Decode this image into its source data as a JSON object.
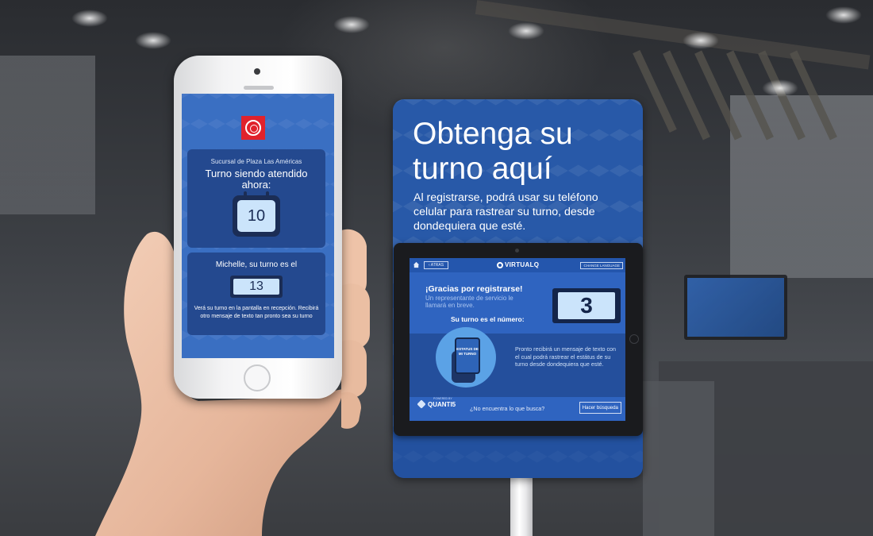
{
  "phone": {
    "branch": "Sucursal de Plaza Las Américas",
    "now_serving": "Turno siendo atendido ahora:",
    "serving_number": "10",
    "user_line": "Michelle, su turno es el",
    "user_number": "13",
    "message": "Verá su turno en la pantalla en recepción. Recibirá otro mensaje de texto tan pronto sea su turno"
  },
  "kiosk": {
    "title": "Obtenga su turno aquí",
    "subtitle": "Al registrarse, podrá usar su teléfono celular para rastrear su turno, desde dondequiera que esté."
  },
  "tablet": {
    "back_label": "‹ ATRAS",
    "brand": "VIRTUALQ",
    "language_label": "CHANGE LANGUAGE",
    "thanks": "¡Gracias por registrarse!",
    "representative": "Un representante de servicio le llamará en breve.",
    "your_turn": "Su turno es el número:",
    "turn_number": "3",
    "status_label": "ESTATUS DE MI TURNO",
    "soon_message": "Pronto recibirá un mensaje de texto con el cual podrá rastrear el estátus de su turno desde dondequiera que esté.",
    "powered_by": "POWERED BY",
    "quantis_logo": "QUANTI5",
    "not_found": "¿No encuentra lo que busca?",
    "search_button": "Hacer búsqueda"
  },
  "icons": {
    "home": "home-icon",
    "bank_logo": "bank-logo-icon"
  },
  "colors": {
    "kiosk_blue": "#2859a8",
    "phone_screen_blue": "#3a6fc2",
    "card_navy": "#24498f",
    "ticket_light": "#cbe4fb",
    "bank_red": "#e0222b"
  }
}
